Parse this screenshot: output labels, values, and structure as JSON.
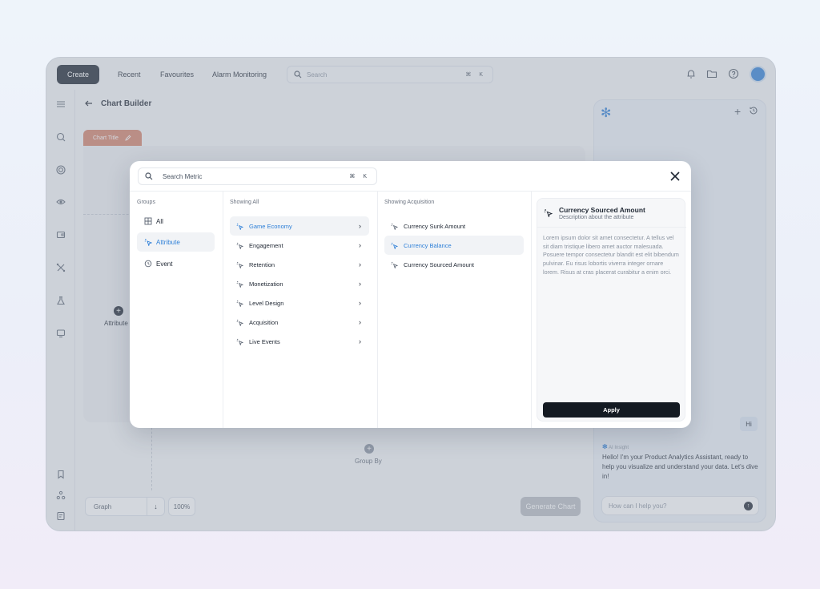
{
  "topbar": {
    "create_label": "Create",
    "nav": [
      "Recent",
      "Favourites",
      "Alarm Monitoring"
    ],
    "search_placeholder": "Search",
    "search_shortcut": "⌘ K"
  },
  "header": {
    "title": "Chart Builder"
  },
  "canvas": {
    "chart_tab_label": "Chart Title",
    "attribute_label": "Attribute",
    "group_by_label": "Group By"
  },
  "bottom": {
    "graph_label": "Graph",
    "zoom": "100%",
    "generate_label": "Generate Chart"
  },
  "assistant": {
    "user_message": "Hi",
    "ai_tag": "AI Insight",
    "ai_message": "Hello! I'm your Product Analytics Assistant, ready to help you visualize and understand your data. Let's dive in!",
    "input_placeholder": "How can I help you?"
  },
  "modal": {
    "search_placeholder": "Search Metric",
    "search_shortcut": "⌘ K",
    "groups_heading": "Groups",
    "groups": [
      {
        "label": "All",
        "selected": false,
        "icon": "grid-icon"
      },
      {
        "label": "Attribute",
        "selected": true,
        "icon": "cursor-click-icon"
      },
      {
        "label": "Event",
        "selected": false,
        "icon": "event-icon"
      }
    ],
    "showing_all_heading": "Showing All",
    "categories": [
      {
        "label": "Game Economy",
        "selected": true
      },
      {
        "label": "Engagement",
        "selected": false
      },
      {
        "label": "Retention",
        "selected": false
      },
      {
        "label": "Monetization",
        "selected": false
      },
      {
        "label": "Level Design",
        "selected": false
      },
      {
        "label": "Acquisition",
        "selected": false
      },
      {
        "label": "Live Events",
        "selected": false
      }
    ],
    "showing_acq_heading": "Showing Acquisition",
    "metrics": [
      {
        "label": "Currency Sunk Amount",
        "selected": false
      },
      {
        "label": "Currency Balance",
        "selected": true
      },
      {
        "label": "Currency Sourced Amount",
        "selected": false
      }
    ],
    "detail": {
      "title": "Currency Sourced Amount",
      "subtitle": "Description about the attribute",
      "body": "Lorem ipsum dolor sit amet consectetur. A tellus vel sit diam tristique libero amet auctor malesuada. Posuere tempor consectetur blandit est elit bibendum pulvinar. Eu risus lobortis viverra integer ornare lorem. Risus at cras placerat curabitur a enim orci.",
      "apply_label": "Apply"
    }
  },
  "colors": {
    "accent": "#2f80d8",
    "dark": "#1b2430",
    "chart_tab": "#d5826a"
  }
}
